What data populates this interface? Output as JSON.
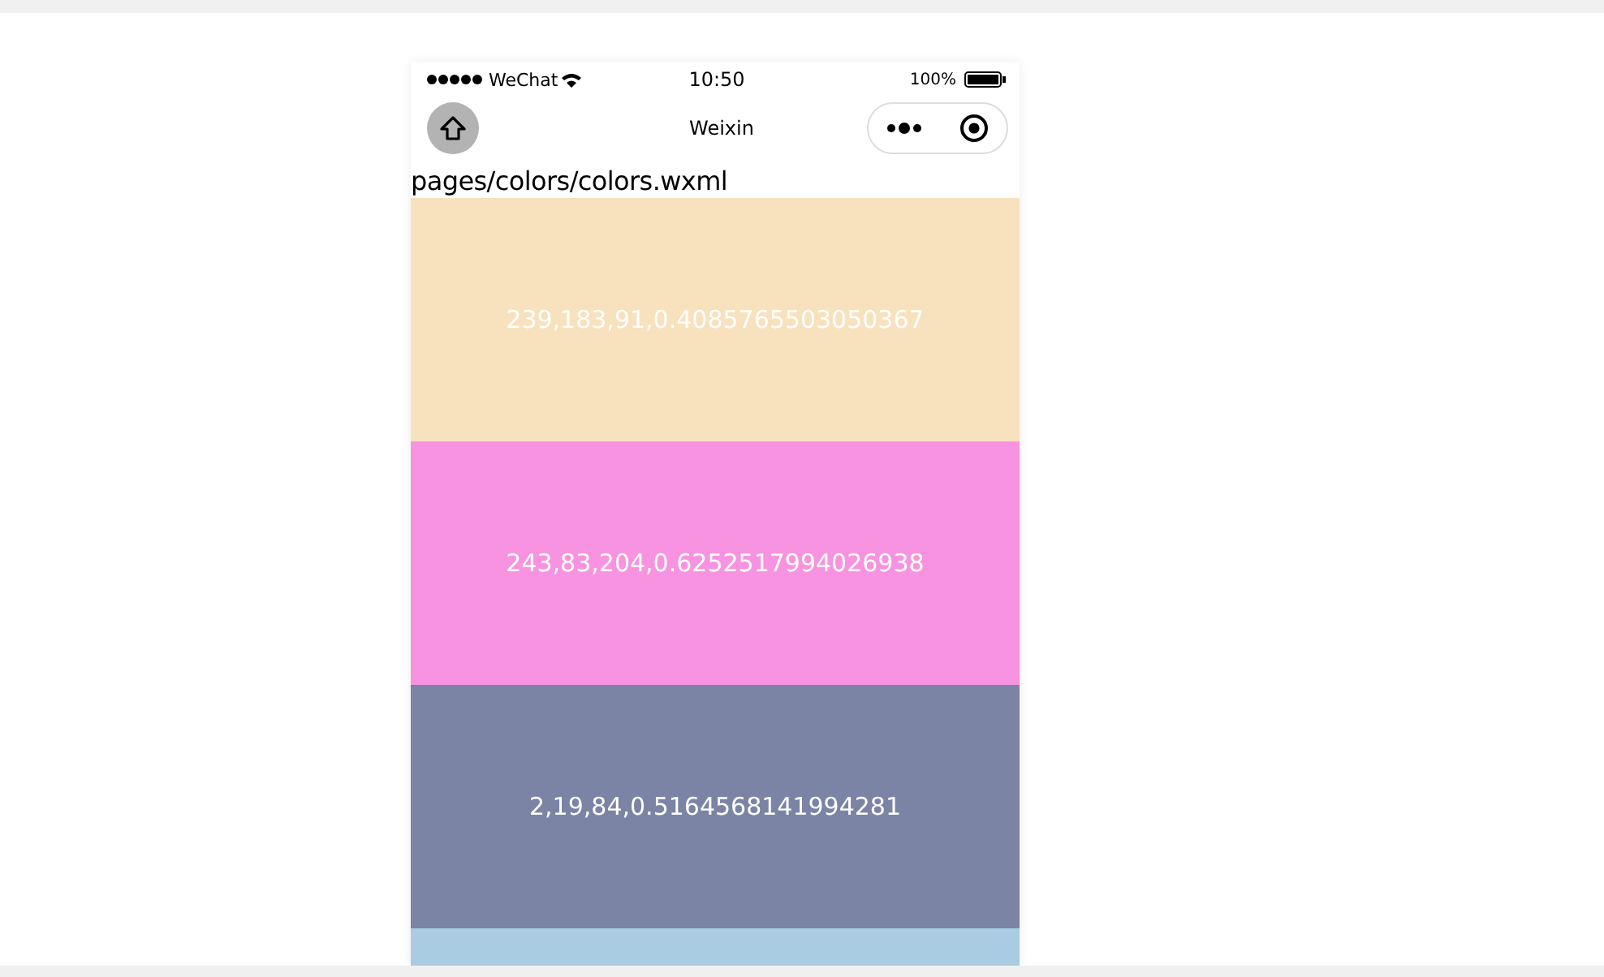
{
  "status_bar": {
    "carrier": "WeChat",
    "time": "10:50",
    "battery": "100%"
  },
  "nav_bar": {
    "title": "Weixin"
  },
  "page_path": "pages/colors/colors.wxml",
  "blocks": [
    {
      "label": "239,183,91,0.4085765503050367",
      "color": "#f8e1bd"
    },
    {
      "label": "243,83,204,0.6252517994026938",
      "color": "#f793e0"
    },
    {
      "label": "2,19,84,0.5164568141994281",
      "color": "#7b84a4"
    },
    {
      "color": "#a9cce3"
    }
  ]
}
